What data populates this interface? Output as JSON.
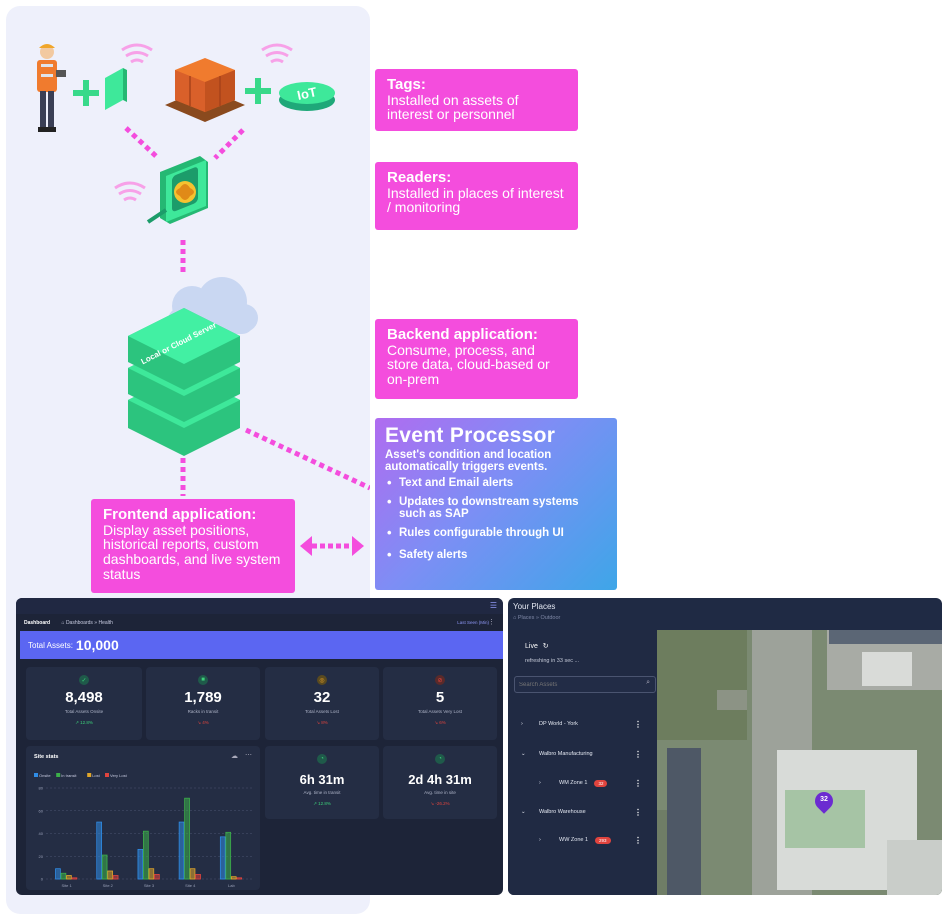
{
  "diagram": {
    "tags": {
      "title": "Tags:",
      "desc": "Installed on assets of interest or personnel"
    },
    "readers": {
      "title": "Readers:",
      "desc": "Installed in places of interest / monitoring"
    },
    "backend": {
      "title": "Backend application:",
      "desc": "Consume, process, and store data, cloud-based or on-prem"
    },
    "frontend": {
      "title": "Frontend application:",
      "desc": "Display asset positions, historical reports, custom dashboards, and live system status"
    },
    "server_label": "Local or Cloud Server",
    "iot_label": "IoT",
    "event_processor": {
      "title": "Event Processor",
      "subtitle": "Asset's condition and location automatically triggers events.",
      "items": [
        "Text and Email alerts",
        "Updates to downstream systems such as SAP",
        "Rules configurable through UI",
        "Safety alerts"
      ]
    },
    "colors": {
      "callout": "#f44ddd",
      "panel": "#eef0fb",
      "server": "#3ee89a"
    }
  },
  "dashboard": {
    "title": "Dashboard",
    "breadcrumb": "Dashboards » Health",
    "last_seen": "Last Seen (Min)",
    "total_label": "Total Assets:",
    "total_value": "10,000",
    "cards": [
      {
        "value": "8,498",
        "label": "Total Assets Onsite",
        "change": "↗ 12.8%",
        "color": "#3cd07a"
      },
      {
        "value": "1,789",
        "label": "Racks in transit",
        "change": "↘ 4%",
        "color": "#e0443e"
      },
      {
        "value": "32",
        "label": "Total Assets Lost",
        "change": "↘ 8%",
        "color": "#e0443e"
      },
      {
        "value": "5",
        "label": "Total Assets Very Lost",
        "change": "↘ 6%",
        "color": "#e0443e"
      },
      {
        "value": "6h 31m",
        "label": "Avg. time in transit",
        "change": "↗ 12.8%",
        "color": "#3cd07a"
      },
      {
        "value": "2d 4h 31m",
        "label": "Avg. time in site",
        "change": "↘ -26.2%",
        "color": "#e0443e"
      }
    ],
    "site_stats_title": "Site stats"
  },
  "chart_data": {
    "type": "bar",
    "title": "Site stats",
    "categories": [
      "Site 1",
      "Site 2",
      "Site 3",
      "Site 4",
      "Lab"
    ],
    "series": [
      {
        "name": "Onsite",
        "color": "#2f8ce6",
        "values": [
          9,
          50,
          26,
          50,
          37
        ]
      },
      {
        "name": "In transit",
        "color": "#3cb04a",
        "values": [
          5,
          21,
          42,
          71,
          41
        ]
      },
      {
        "name": "Lost",
        "color": "#e0a62a",
        "values": [
          3,
          7,
          9,
          9,
          2
        ]
      },
      {
        "name": "Very Lost",
        "color": "#e0443e",
        "values": [
          1,
          3,
          4,
          4,
          1
        ]
      }
    ],
    "ylim": [
      0,
      80
    ],
    "yticks": [
      0,
      20,
      40,
      60,
      80
    ],
    "grid": true,
    "legend": "top-left"
  },
  "places": {
    "title": "Your Places",
    "breadcrumb": "Places » Outdoor",
    "live": "Live",
    "refresh": "refreshing in 33 sec ...",
    "search_placeholder": "Search Assets",
    "items": [
      {
        "label": "DP World - York",
        "badge": ""
      },
      {
        "label": "Walbro Manufacturing",
        "badge": ""
      },
      {
        "label": "WM Zone 1",
        "badge": "32"
      },
      {
        "label": "Walbro Warehouse",
        "badge": ""
      },
      {
        "label": "WW Zone 1",
        "badge": "293"
      }
    ],
    "map_pin": "32"
  }
}
